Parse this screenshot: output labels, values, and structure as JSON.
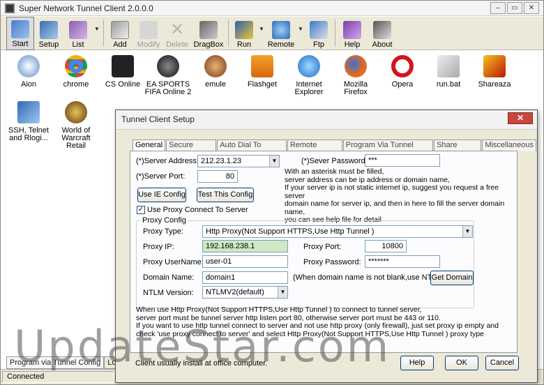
{
  "app": {
    "title": "Super Network Tunnel Client 2.0.0.0"
  },
  "toolbar": {
    "start": "Start",
    "setup": "Setup",
    "list": "List",
    "add": "Add",
    "modify": "Modify",
    "delete": "Delete",
    "dragbox": "DragBox",
    "run": "Run",
    "remote": "Remote",
    "ftp": "Ftp",
    "help": "Help",
    "about": "About"
  },
  "desktop": {
    "icons": [
      {
        "label": "Aion"
      },
      {
        "label": "chrome"
      },
      {
        "label": "CS Online"
      },
      {
        "label": "EA SPORTS FIFA Online 2"
      },
      {
        "label": "emule"
      },
      {
        "label": "Flashget"
      },
      {
        "label": "Internet Explorer"
      },
      {
        "label": "Mozilla Firefox"
      },
      {
        "label": "Opera"
      },
      {
        "label": "run.bat"
      },
      {
        "label": "Shareaza"
      },
      {
        "label": "SSH, Telnet and Rlogi..."
      },
      {
        "label": "World of Warcraft Retail"
      }
    ]
  },
  "bottom_tabs": {
    "tab1": "Program via Tunnel Config",
    "tab2": "Log an"
  },
  "status": {
    "text": "Connected"
  },
  "watermark": "UpdateStar.com",
  "dialog": {
    "title": "Tunnel Client Setup",
    "close": "✕",
    "tabs": [
      "General",
      "Secure Config",
      "Auto Dial To Internet",
      "Remote Control",
      "Program Via Tunnel Config",
      "Share Tunnel",
      "Miscellaneous"
    ],
    "server_address_label": "(*)Server Address:",
    "server_address": "212.23.1.23",
    "server_password_label": "(*)Sever Password:",
    "server_password": "***",
    "server_port_label": "(*)Server Port:",
    "server_port": "80",
    "hint": "With an asterisk must be filled,\nserver address can be ip address or domain name,\nIf your server ip is not static internet ip, suggest you request a free server\n domain name for server ip, and then in here to fill the server domain name,\nyou can see help file for detail",
    "use_ie_config": "Use IE Config",
    "test_config": "Test This Config",
    "use_proxy": "Use Proxy Connect To Server",
    "use_proxy_checked": "✓",
    "proxy_group": "Proxy Config",
    "proxy_type_label": "Proxy Type:",
    "proxy_type": "Http Proxy(Not Support HTTPS,Use Http Tunnel )",
    "proxy_ip_label": "Proxy IP:",
    "proxy_ip": "192.168.238.1",
    "proxy_port_label": "Proxy Port:",
    "proxy_port": "10800",
    "proxy_user_label": "Proxy UserName:",
    "proxy_user": "user-01",
    "proxy_password_label": "Proxy Password:",
    "proxy_password": "*******",
    "domain_label": "Domain Name:",
    "domain": "domain1",
    "domain_note": "(When domain name is not blank,use NTLM)",
    "get_domain": "Get Domain",
    "ntlm_label": "NTLM Version:",
    "ntlm": "NTLMV2(default)",
    "info": "When use Http Proxy(Not Support HTTPS,Use Http Tunnel ) to connect to tunnel server,\nserver port must be tunnel server http listen port 80, otherwise server port must be 443 or 110.\nIf you want to use http tunnel connect to server and not use http proxy (only firewall), just set proxy ip empty and\ncheck 'use proxy connect to server' and select Http Proxy(Not Support HTTPS,Use Http Tunnel ) proxy type",
    "footer_note": "Client usually install at office computer.",
    "help": "Help",
    "ok": "OK",
    "cancel": "Cancel"
  },
  "colors": {
    "proxy_ip_bg": "#cfe8c5",
    "close_red": "#c9463d",
    "toolbar_bg": "#ece9d8"
  }
}
